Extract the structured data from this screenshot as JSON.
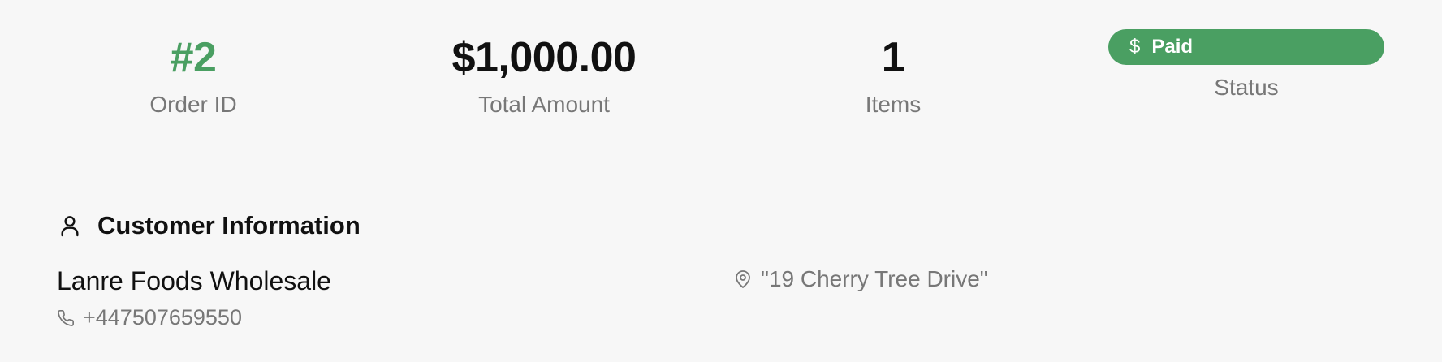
{
  "summary": {
    "order_id": "#2",
    "order_id_label": "Order ID",
    "total_amount": "$1,000.00",
    "total_amount_label": "Total Amount",
    "items_count": "1",
    "items_label": "Items",
    "status": {
      "icon_glyph": "$",
      "text": "Paid",
      "label": "Status",
      "color": "#4a9f62"
    }
  },
  "customer": {
    "section_title": "Customer Information",
    "name": "Lanre Foods Wholesale",
    "phone": "+447507659550",
    "address": "\"19 Cherry Tree Drive\""
  },
  "icons": {
    "section": "user-icon",
    "phone": "phone-icon",
    "address": "map-pin-icon",
    "status": "dollar-icon"
  },
  "colors": {
    "accent": "#4a9f62",
    "muted_text": "#777777",
    "background": "#f7f7f7"
  }
}
